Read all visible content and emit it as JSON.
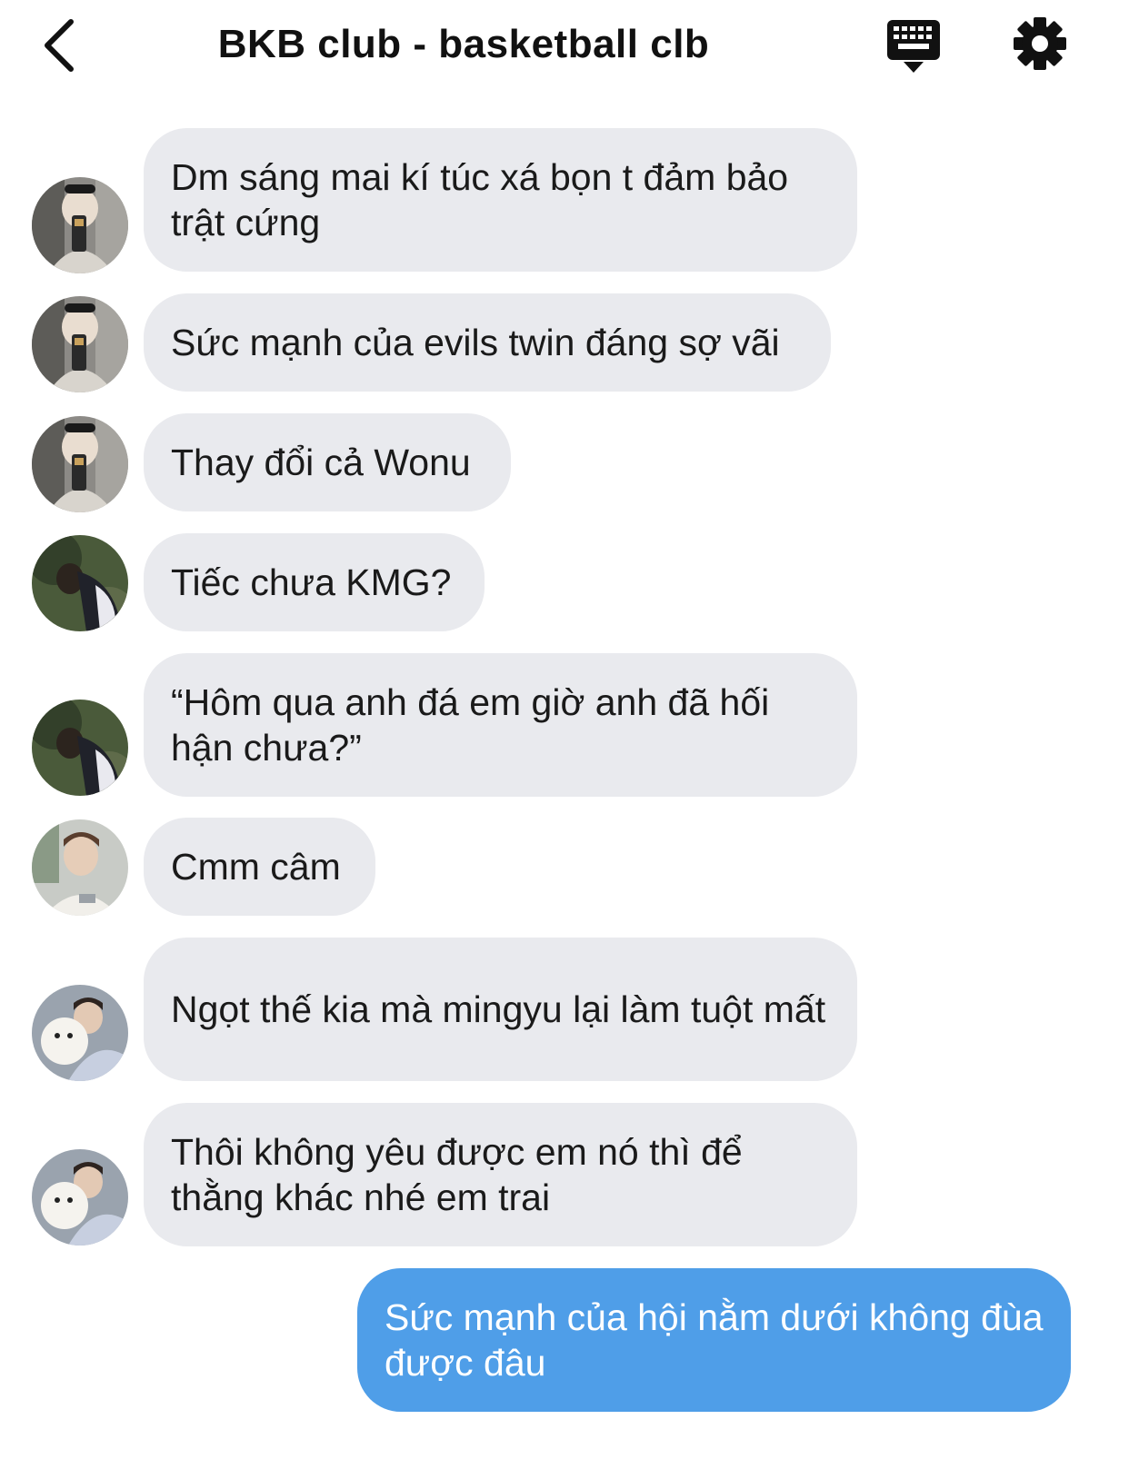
{
  "header": {
    "title": "BKB club - basketball clb",
    "back_icon": "chevron-left-icon",
    "keyboard_icon": "keyboard-icon",
    "settings_icon": "gear-icon"
  },
  "messages": [
    {
      "sender": "received",
      "avatar": "avatar-1",
      "text": "Dm sáng mai kí túc xá bọn t đảm bảo trật cứng"
    },
    {
      "sender": "received",
      "avatar": "avatar-1",
      "text": "Sức mạnh của evils twin đáng sợ vãi"
    },
    {
      "sender": "received",
      "avatar": "avatar-1",
      "text": "Thay đổi cả Wonu"
    },
    {
      "sender": "received",
      "avatar": "avatar-2",
      "text": "Tiếc chưa KMG?"
    },
    {
      "sender": "received",
      "avatar": "avatar-2",
      "text": "“Hôm qua anh đá em giờ anh đã hối hận chưa?”"
    },
    {
      "sender": "received",
      "avatar": "avatar-3",
      "text": "Cmm câm"
    },
    {
      "sender": "received",
      "avatar": "avatar-4",
      "text": "Ngọt thế kia mà mingyu lại làm tuột mất"
    },
    {
      "sender": "received",
      "avatar": "avatar-4",
      "text": "Thôi không yêu được em nó thì để thằng khác nhé em trai"
    },
    {
      "sender": "sent",
      "text": "Sức mạnh của hội nằm dưới không đùa được đâu"
    }
  ],
  "colors": {
    "received_bubble": "#e9eaee",
    "sent_bubble": "#4f9ee8",
    "sent_text": "#ffffff"
  }
}
